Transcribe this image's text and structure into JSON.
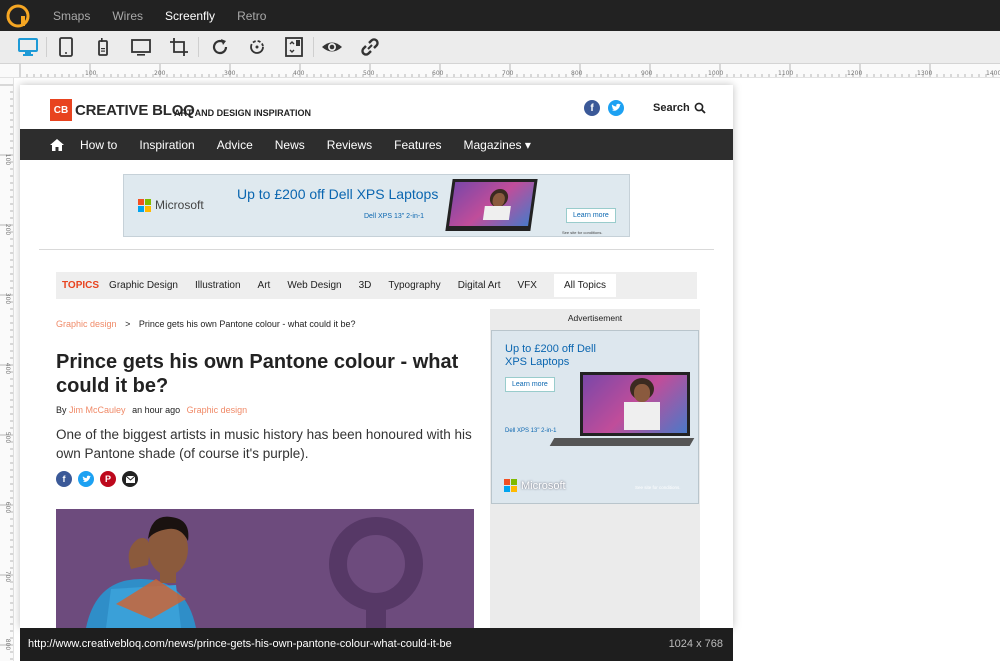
{
  "app": {
    "menu": [
      "Smaps",
      "Wires",
      "Screenfly",
      "Retro"
    ],
    "active_menu": "Screenfly"
  },
  "toolbar": {
    "buttons": [
      "desktop-icon",
      "tablet-icon",
      "phone-icon",
      "tv-icon",
      "crop-icon",
      "refresh-icon",
      "rotate-icon",
      "scroll-icon",
      "eye-icon",
      "link-icon"
    ]
  },
  "ruler": {
    "h_labels": [
      "100",
      "200",
      "300",
      "400",
      "500",
      "600",
      "700",
      "800",
      "900",
      "1000",
      "1100",
      "1200",
      "1300",
      "1400"
    ],
    "v_labels": [
      "100",
      "200",
      "300",
      "400",
      "500",
      "600",
      "700",
      "800"
    ]
  },
  "site": {
    "logo_mark": "CB",
    "logo_word": "CREATIVE BLOQ",
    "tagline": "ART AND DESIGN INSPIRATION",
    "search": "Search",
    "nav": [
      "How to",
      "Inspiration",
      "Advice",
      "News",
      "Reviews",
      "Features",
      "Magazines ▾"
    ],
    "banner": {
      "brand": "Microsoft",
      "headline": "Up to £200 off Dell XPS Laptops",
      "cta": "Learn more",
      "product": "Dell XPS 13\" 2-in-1",
      "fine": "See site for conditions."
    },
    "topics": {
      "label": "TOPICS",
      "items": [
        "Graphic Design",
        "Illustration",
        "Art",
        "Web Design",
        "3D",
        "Typography",
        "Digital Art",
        "VFX"
      ],
      "all": "All Topics"
    },
    "article": {
      "breadcrumb_cat": "Graphic design",
      "breadcrumb_sep": ">",
      "breadcrumb_title": "Prince gets his own Pantone colour - what could it be?",
      "headline": "Prince gets his own Pantone colour - what could it be?",
      "by": "By",
      "author": "Jim McCauley",
      "time": "an hour ago",
      "category": "Graphic design",
      "standfirst": "One of the biggest artists in music history has been honoured with his own Pantone shade (of course it's purple)."
    },
    "side_ad": {
      "label": "Advertisement",
      "headline": "Up to £200 off Dell XPS Laptops",
      "cta": "Learn more",
      "product": "Dell XPS 13\" 2-in-1",
      "brand": "Microsoft",
      "fine": "See site for conditions."
    }
  },
  "status": {
    "url": "http://www.creativebloq.com/news/prince-gets-his-own-pantone-colour-what-could-it-be",
    "dims": "1024 x 768"
  },
  "colors": {
    "brand_orange": "#e8431f",
    "link_orange": "#f08a68",
    "nav_bg": "#2d2d2d",
    "toolbar_active": "#1e9ad6",
    "facebook": "#3b5998",
    "twitter": "#1da1f2",
    "pinterest": "#bd081c"
  }
}
